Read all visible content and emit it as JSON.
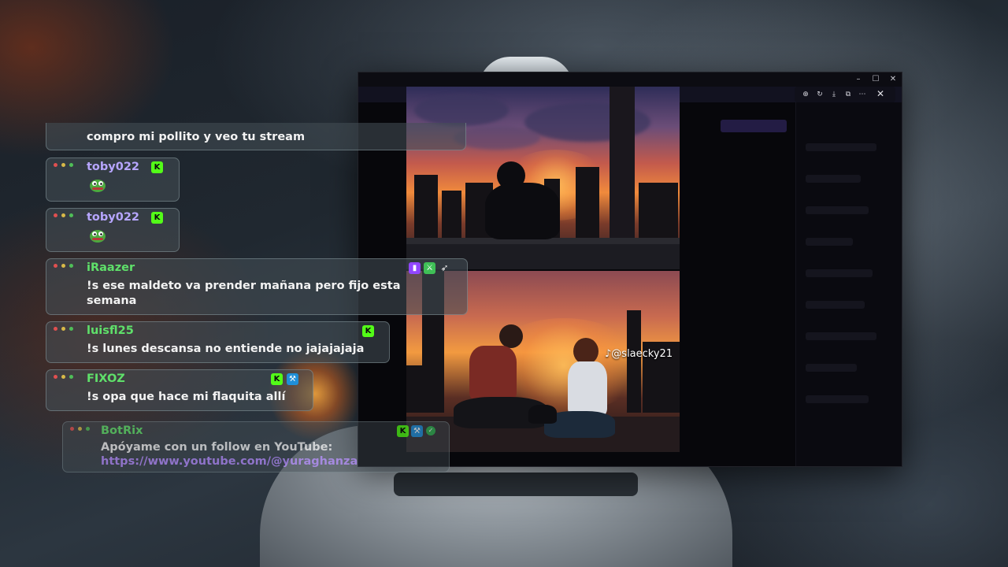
{
  "app_window": {
    "title": "",
    "controls": {
      "minimize": "–",
      "maximize": "☐",
      "close": "✕"
    }
  },
  "image_viewer": {
    "toolbar_icons": [
      "zoom-in-icon",
      "rotate-icon",
      "download-icon",
      "external-icon",
      "more-icon"
    ],
    "close_label": "✕",
    "watermark": "@slaecky21"
  },
  "chat": {
    "messages": [
      {
        "user": "",
        "text": "compro mi pollito y veo tu stream",
        "user_color": "#c8b8ff"
      },
      {
        "user": "toby022",
        "text": "",
        "user_color": "#b7a6ff",
        "emote": "pepe-emote",
        "badges": [
          "kick"
        ]
      },
      {
        "user": "toby022",
        "text": "",
        "user_color": "#b7a6ff",
        "emote": "pepe-emote",
        "badges": [
          "kick"
        ]
      },
      {
        "user": "iRaazer",
        "text": "!s ese maldeto va prender mañana pero fijo esta semana",
        "user_color": "#5fe06a",
        "badges": [
          "twitch",
          "sword",
          "rocket"
        ]
      },
      {
        "user": "luisfl25",
        "text": "!s lunes descansa no entiende no jajajajaja",
        "user_color": "#5fe06a",
        "badges": [
          "kick"
        ]
      },
      {
        "user": "FIXOZ",
        "text": "!s opa que hace mi flaquita allí",
        "user_color": "#5fe06a",
        "badges": [
          "kick",
          "blue"
        ]
      },
      {
        "user": "BotRix",
        "text": "Apóyame con un follow en YouTube:",
        "link": "https://www.youtube.com/@yuraghanza",
        "user_color": "#5fe06a",
        "badges": [
          "kick",
          "blue",
          "check"
        ]
      }
    ]
  },
  "colors": {
    "link": "#b58cff",
    "kick_green": "#53fc18",
    "twitch_purple": "#9146ff"
  }
}
